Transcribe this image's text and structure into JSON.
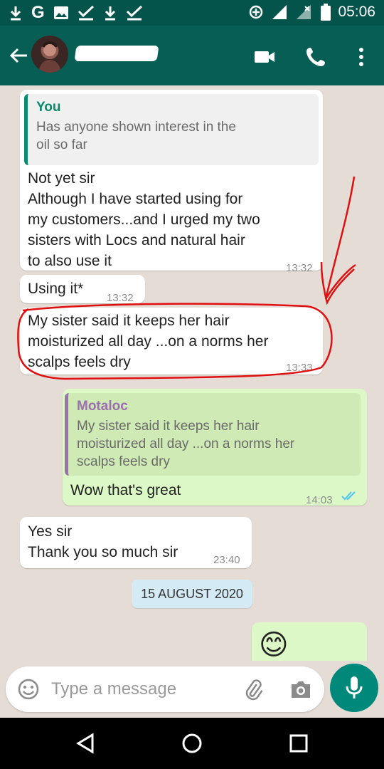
{
  "status_bar": {
    "left_icons": [
      "download-icon",
      "google-icon",
      "image-icon",
      "check-download-icon",
      "download-icon",
      "check-download-icon"
    ],
    "right_icons": [
      "data-saver-icon",
      "signal-icon",
      "signal-no-data-icon",
      "battery-icon"
    ],
    "time": "05:06"
  },
  "app_bar": {
    "icons": [
      "back-arrow-icon",
      "video-call-icon",
      "phone-icon",
      "more-vert-icon"
    ]
  },
  "messages": [
    {
      "direction": "incoming",
      "quote": {
        "name": "You",
        "text": "Has anyone shown interest in the\noil so far"
      },
      "text": "Not yet sir\nAlthough I have started using for\nmy customers...and I urged my two\nsisters with Locs and natural hair\nto also use it",
      "time": "13:32"
    },
    {
      "direction": "incoming",
      "text": "Using it*",
      "time": "13:32"
    },
    {
      "direction": "incoming",
      "text": "My sister said it keeps her hair\nmoisturized all day ...on a norms her\nscalps feels dry",
      "time": "13:33"
    },
    {
      "direction": "outgoing",
      "quote": {
        "name": "Motaloc",
        "text": "My sister said it keeps her hair\nmoisturized all day ...on a norms her\nscalps feels dry"
      },
      "text": "Wow that's great",
      "time": "14:03",
      "status": "read-double-check-icon"
    },
    {
      "direction": "incoming",
      "text": "Yes sir\nThank you so much sir",
      "time": "23:40"
    },
    {
      "direction": "outgoing",
      "emoji": "😊"
    }
  ],
  "date_separator": "15 AUGUST 2020",
  "composer": {
    "placeholder": "Type a message",
    "icons": [
      "emoji-icon",
      "attach-icon",
      "camera-icon",
      "mic-icon"
    ]
  },
  "nav_bar": {
    "icons": [
      "nav-back-icon",
      "nav-home-icon",
      "nav-recents-icon"
    ]
  },
  "colors": {
    "status_bar": "#04544c",
    "app_bar": "#075e54",
    "chat_background": "#e5ddd5",
    "incoming_bubble": "#ffffff",
    "outgoing_bubble": "#dcf8c6",
    "quote_you_accent": "#0a8a6e",
    "quote_other_accent": "#9c6fb0",
    "read_ticks": "#4fc3f7",
    "mic_button": "#00897b",
    "annotation": "#e01010"
  }
}
